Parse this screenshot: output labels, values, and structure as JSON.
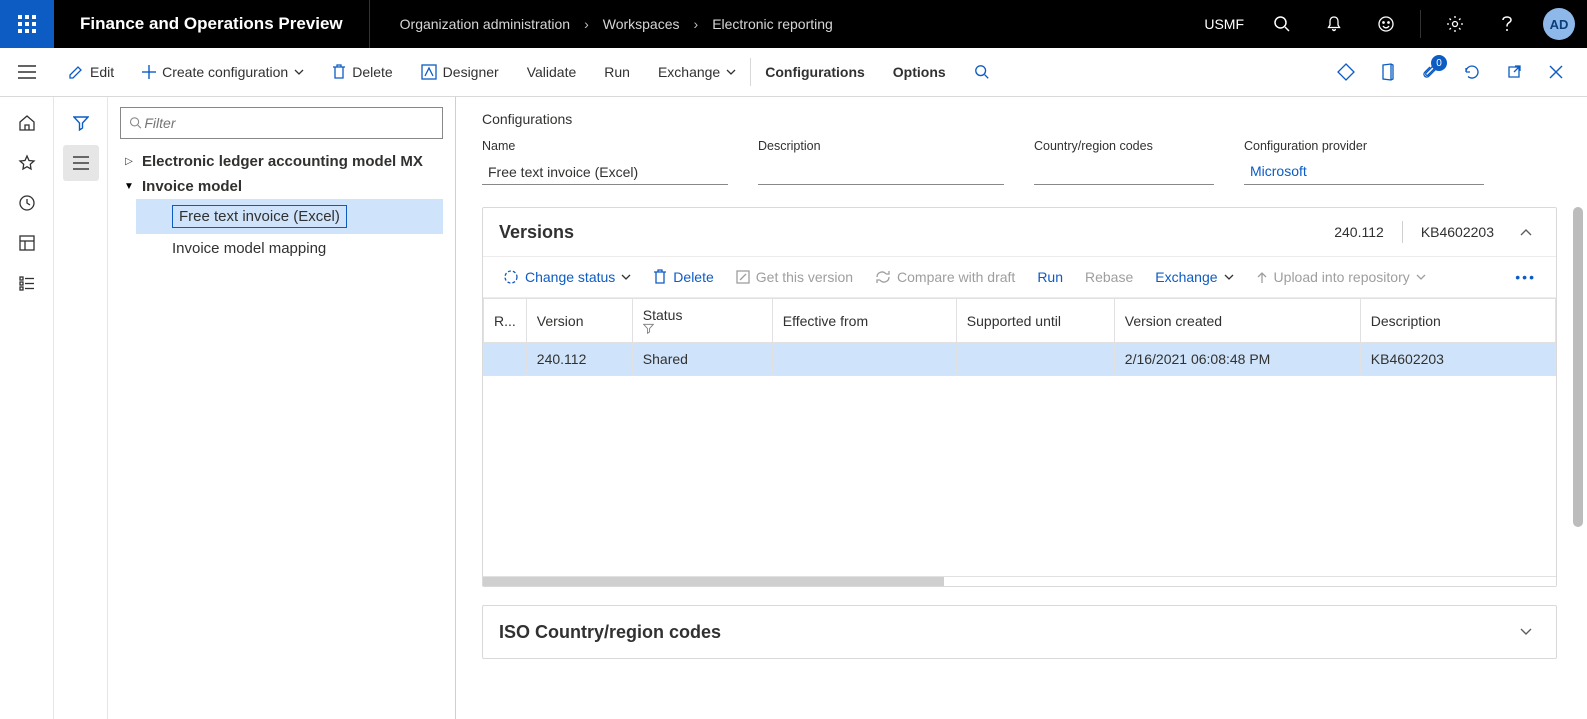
{
  "app": {
    "title": "Finance and Operations Preview",
    "company": "USMF",
    "avatar": "AD"
  },
  "breadcrumb": [
    "Organization administration",
    "Workspaces",
    "Electronic reporting"
  ],
  "actionbar": {
    "edit": "Edit",
    "create": "Create configuration",
    "delete": "Delete",
    "designer": "Designer",
    "validate": "Validate",
    "run": "Run",
    "exchange": "Exchange",
    "configurations": "Configurations",
    "options": "Options",
    "badge": "0"
  },
  "filter": {
    "placeholder": "Filter"
  },
  "tree": {
    "node1": "Electronic ledger accounting model MX",
    "node2": "Invoice model",
    "leaf_selected": "Free text invoice (Excel)",
    "leaf2": "Invoice model mapping"
  },
  "section": {
    "title": "Configurations"
  },
  "fields": {
    "name_lbl": "Name",
    "name_val": "Free text invoice (Excel)",
    "desc_lbl": "Description",
    "desc_val": "",
    "codes_lbl": "Country/region codes",
    "codes_val": "",
    "provider_lbl": "Configuration provider",
    "provider_val": "Microsoft"
  },
  "versions": {
    "title": "Versions",
    "meta_ver": "240.112",
    "meta_desc": "KB4602203",
    "toolbar": {
      "change_status": "Change status",
      "delete": "Delete",
      "get": "Get this version",
      "compare": "Compare with draft",
      "run": "Run",
      "rebase": "Rebase",
      "exchange": "Exchange",
      "upload": "Upload into repository"
    },
    "cols": {
      "r": "R...",
      "version": "Version",
      "status": "Status",
      "eff": "Effective from",
      "sup": "Supported until",
      "created": "Version created",
      "desc": "Description"
    },
    "rows": [
      {
        "version": "240.112",
        "status": "Shared",
        "eff": "",
        "sup": "",
        "created": "2/16/2021 06:08:48 PM",
        "desc": "KB4602203"
      }
    ]
  },
  "iso": {
    "title": "ISO Country/region codes"
  }
}
